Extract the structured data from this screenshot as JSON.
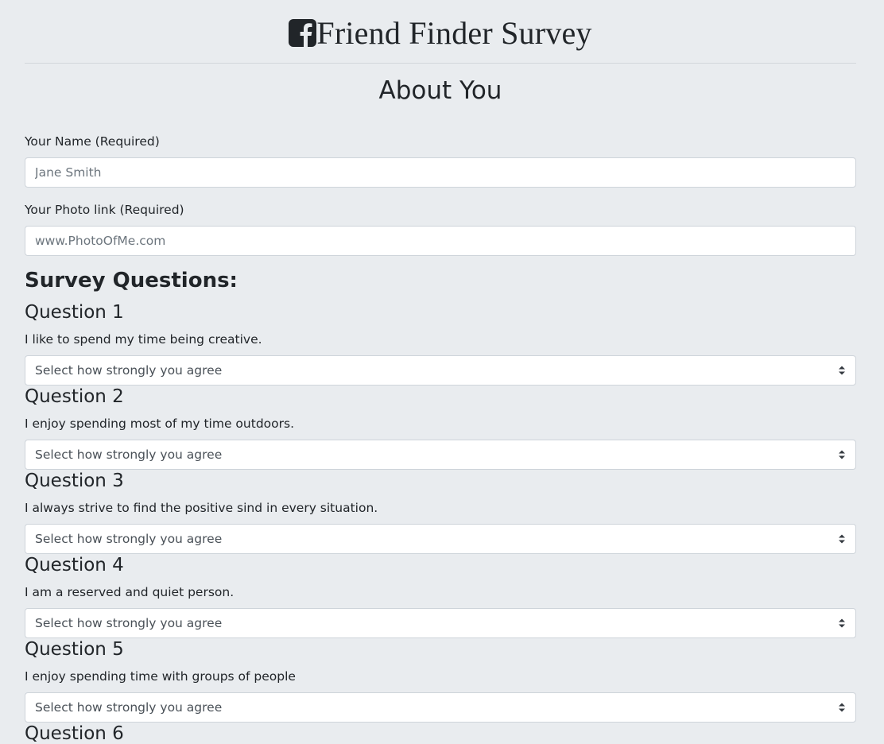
{
  "header": {
    "logo_icon": "facebook-square-icon",
    "app_title": "Friend Finder Survey"
  },
  "about": {
    "section_title": "About You",
    "name_label": "Your Name (Required)",
    "name_placeholder": "Jane Smith",
    "name_value": "",
    "photo_label": "Your Photo link (Required)",
    "photo_placeholder": "www.PhotoOfMe.com",
    "photo_value": ""
  },
  "survey": {
    "section_title": "Survey Questions:",
    "select_placeholder": "Select how strongly you agree",
    "questions": [
      {
        "title": "Question 1",
        "text": "I like to spend my time being creative."
      },
      {
        "title": "Question 2",
        "text": "I enjoy spending most of my time outdoors."
      },
      {
        "title": "Question 3",
        "text": "I always strive to find the positive sind in every situation."
      },
      {
        "title": "Question 4",
        "text": "I am a reserved and quiet person."
      },
      {
        "title": "Question 5",
        "text": "I enjoy spending time with groups of people"
      },
      {
        "title": "Question 6",
        "text": ""
      }
    ]
  },
  "colors": {
    "background": "#e9ecef",
    "text": "#212529",
    "input_border": "#ced4da"
  }
}
